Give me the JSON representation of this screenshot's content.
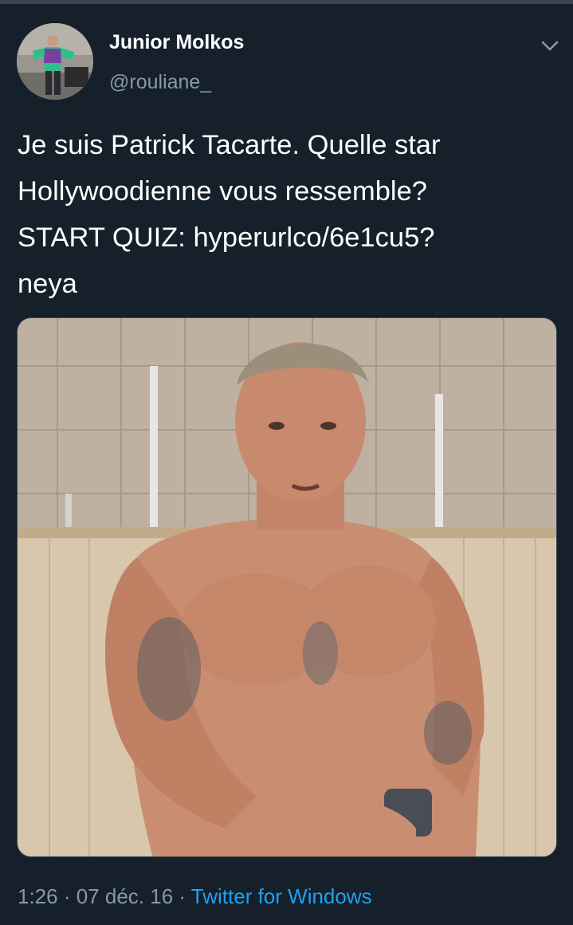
{
  "tweet": {
    "author": {
      "name": "Junior Molkos",
      "handle": "@rouliane_"
    },
    "text": "Je suis Patrick Tacarte. Quelle star\nHollywoodienne vous ressemble?\nSTART QUIZ: hyperurlco/6e1cu5?\nneya",
    "meta": {
      "time": "1:26",
      "separator": " · ",
      "date": "07 déc. 16",
      "source": "Twitter for Windows"
    }
  },
  "icons": {
    "menu": "chevron-down-icon",
    "avatar": "avatar-photo",
    "media": "tweet-photo"
  },
  "colors": {
    "background": "#15202b",
    "text_primary": "#ffffff",
    "text_secondary": "#8899a6",
    "link": "#1da1f2"
  }
}
